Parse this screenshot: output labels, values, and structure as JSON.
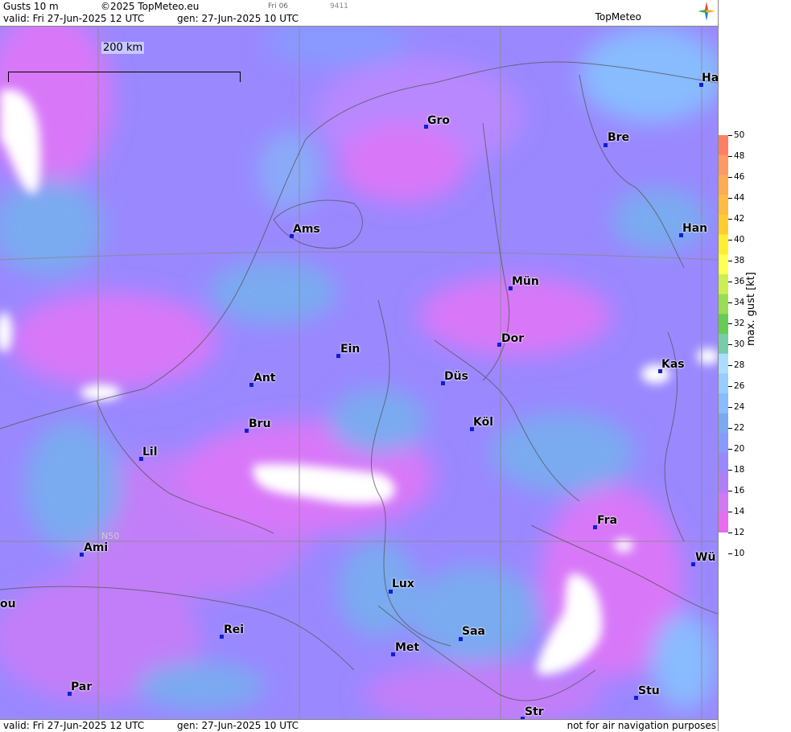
{
  "header": {
    "title": "Gusts 10 m",
    "copyright": "©2025 TopMeteo.eu",
    "run": "Fri 06",
    "code": "9411",
    "valid": "valid:  Fri  27-Jun-2025  12 UTC",
    "gen": "gen:  27-Jun-2025 10 UTC",
    "logo": "TopMeteo"
  },
  "footer": {
    "valid": "valid:  Fri  27-Jun-2025  12 UTC",
    "gen": "gen:  27-Jun-2025 10 UTC",
    "note": "not for air navigation purposes"
  },
  "scale_label": "200 km",
  "grid_label": "N50",
  "legend": {
    "title": "max. gust [kt]",
    "ticks": [
      "50",
      "48",
      "46",
      "44",
      "42",
      "40",
      "38",
      "36",
      "34",
      "32",
      "30",
      "28",
      "26",
      "24",
      "22",
      "20",
      "18",
      "16",
      "14",
      "12",
      "10"
    ],
    "colors": [
      "#ff7f66",
      "#ff9966",
      "#ffaa55",
      "#ffbb44",
      "#ffcc33",
      "#ffee33",
      "#ffff55",
      "#ccee55",
      "#99dd55",
      "#66cc55",
      "#77ccaa",
      "#aaddff",
      "#99ccff",
      "#88bbff",
      "#7aaaf0",
      "#8899ff",
      "#9a88ff",
      "#b07ff8",
      "#d078f5",
      "#e86cf0"
    ]
  },
  "cities": [
    {
      "name": "Ha"
    },
    {
      "name": "Gro"
    },
    {
      "name": "Bre"
    },
    {
      "name": "Ams"
    },
    {
      "name": "Han"
    },
    {
      "name": "Mün"
    },
    {
      "name": "Ein"
    },
    {
      "name": "Dor"
    },
    {
      "name": "Kas"
    },
    {
      "name": "Ant"
    },
    {
      "name": "Düs"
    },
    {
      "name": "Bru"
    },
    {
      "name": "Köl"
    },
    {
      "name": "Lil"
    },
    {
      "name": "Fra"
    },
    {
      "name": "Ami"
    },
    {
      "name": "Wü"
    },
    {
      "name": "Lux"
    },
    {
      "name": "Rei"
    },
    {
      "name": "Saa"
    },
    {
      "name": "ou"
    },
    {
      "name": "Met"
    },
    {
      "name": "Par"
    },
    {
      "name": "Stu"
    },
    {
      "name": "Str"
    }
  ]
}
